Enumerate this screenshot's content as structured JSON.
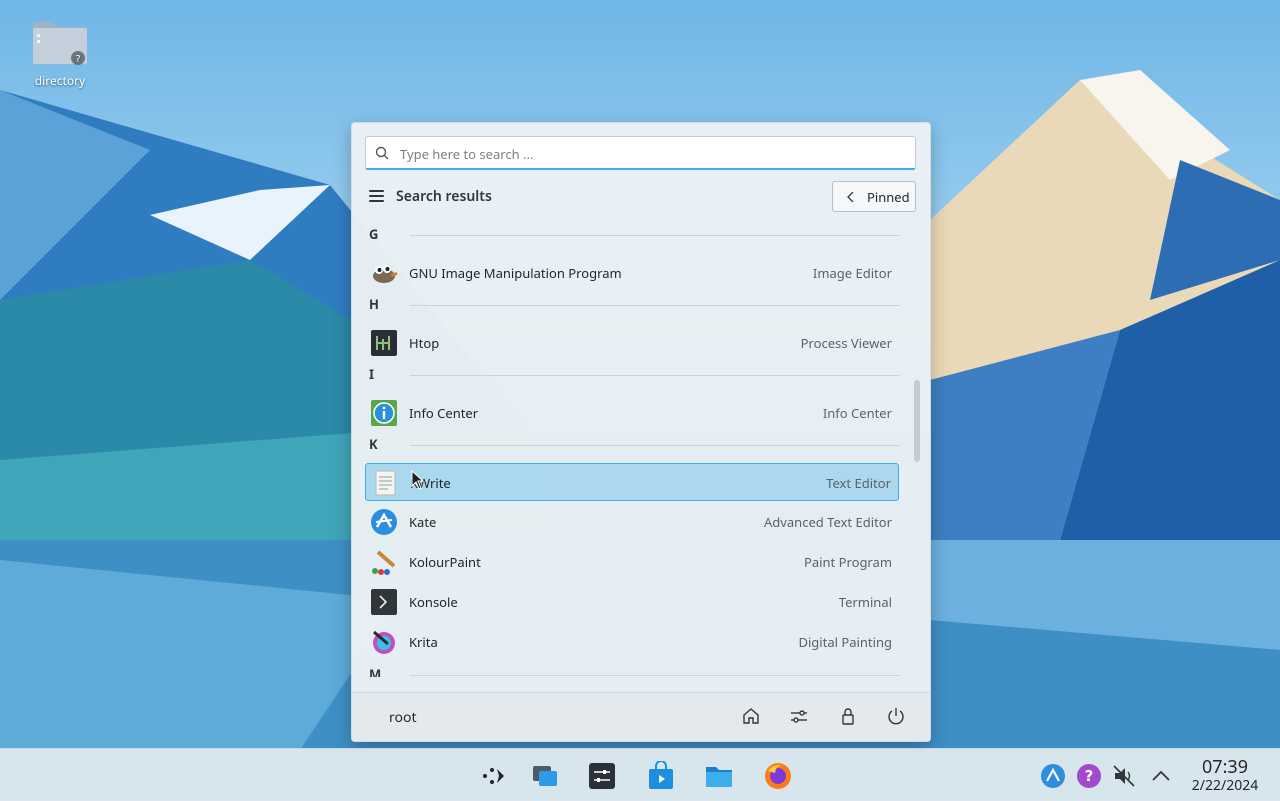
{
  "desktop": {
    "icon_label": "directory"
  },
  "launcher": {
    "search": {
      "placeholder": "Type here to search ...",
      "value": ""
    },
    "header": {
      "title": "Search results",
      "pinned_label": "Pinned"
    },
    "sections": [
      {
        "letter": "G"
      },
      {
        "letter": "H"
      },
      {
        "letter": "I"
      },
      {
        "letter": "K"
      },
      {
        "letter": "M"
      }
    ],
    "apps": [
      {
        "name": "GNU Image Manipulation Program",
        "desc": "Image Editor",
        "icon": "gimp-icon"
      },
      {
        "name": "Htop",
        "desc": "Process Viewer",
        "icon": "htop-icon"
      },
      {
        "name": "Info Center",
        "desc": "Info Center",
        "icon": "info-center-icon"
      },
      {
        "name": "KWrite",
        "desc": "Text Editor",
        "icon": "kwrite-icon"
      },
      {
        "name": "Kate",
        "desc": "Advanced Text Editor",
        "icon": "kate-icon"
      },
      {
        "name": "KolourPaint",
        "desc": "Paint Program",
        "icon": "kolourpaint-icon"
      },
      {
        "name": "Konsole",
        "desc": "Terminal",
        "icon": "konsole-icon"
      },
      {
        "name": "Krita",
        "desc": "Digital Painting",
        "icon": "krita-icon"
      }
    ],
    "footer": {
      "user": "root"
    }
  },
  "taskbar": {
    "clock_time": "07:39",
    "clock_date": "2/22/2024"
  },
  "colors": {
    "accent": "#3daee9",
    "panel": "#dee8ee"
  }
}
